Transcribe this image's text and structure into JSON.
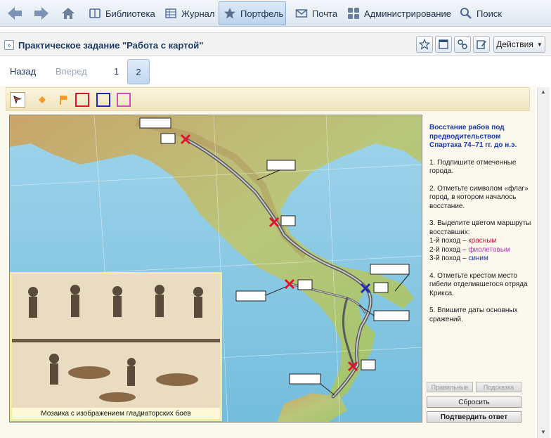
{
  "nav": {
    "items": [
      {
        "label": "Библиотека"
      },
      {
        "label": "Журнал"
      },
      {
        "label": "Портфель"
      },
      {
        "label": "Почта"
      },
      {
        "label": "Администрирование"
      },
      {
        "label": "Поиск"
      }
    ],
    "active_index": 2
  },
  "titlebar": {
    "title": "Практическое задание \"Работа с картой\"",
    "actions_label": "Действия"
  },
  "pager": {
    "back": "Назад",
    "forward": "Вперед",
    "pages": [
      "1",
      "2"
    ],
    "current_page": "2"
  },
  "mosaic": {
    "caption": "Мозаика с изображением гладиаторских боев"
  },
  "task": {
    "header": "Восстание рабов под предводительством Спартака 74–71 гг. до н.э.",
    "step1": "1. Подпишите отмеченные города.",
    "step2": "2. Отметьте символом «флаг» город, в котором началось восстание.",
    "step3_intro": "3. Выделите цветом маршруты восставших:",
    "route1_prefix": "1-й поход –",
    "route1_color": "красным",
    "route2_prefix": "2-й поход –",
    "route2_color": "фиолетовым",
    "route3_prefix": "3-й поход –",
    "route3_color": "синим",
    "step4": "4. Отметьте крестом место гибели отделившегося отряда Крикса.",
    "step5": "5. Впишите даты основных сражений."
  },
  "buttons": {
    "correct": "Правильные",
    "hint": "Подсказка",
    "reset": "Сбросить",
    "submit": "Подтвердить ответ"
  },
  "colors": {
    "accent": "#1c3a66",
    "marker_red": "#e0142c",
    "marker_blue": "#1e2bb8",
    "route_gray": "#8a8a8a"
  }
}
